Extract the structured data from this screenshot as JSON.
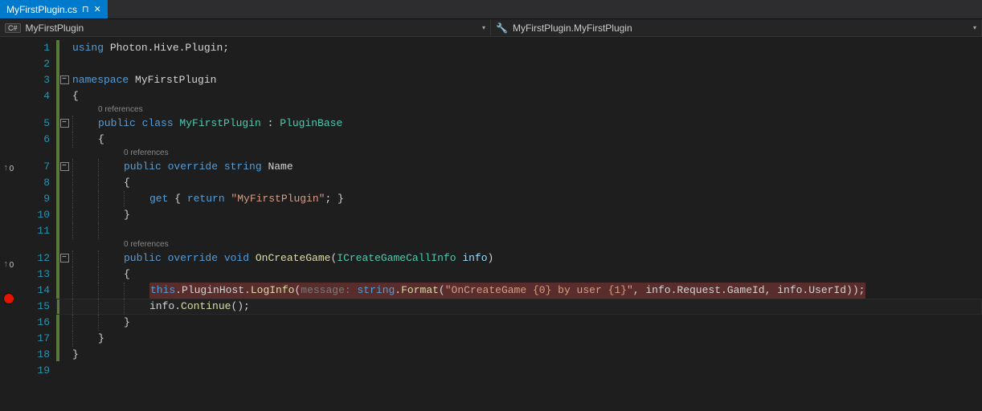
{
  "tab": {
    "filename": "MyFirstPlugin.cs",
    "pin_glyph": "⊓",
    "close_glyph": "✕"
  },
  "nav": {
    "left_badge": "C#",
    "left_text": "MyFirstPlugin",
    "right_icon": "🔧",
    "right_text": "MyFirstPlugin.MyFirstPlugin",
    "arrow": "▾"
  },
  "glyphs": {
    "impl_arrow": "↑",
    "impl_count": "0",
    "fold_minus": "−"
  },
  "codelens": {
    "ref0": "0 references"
  },
  "code": {
    "l1_using": "using",
    "l1_ns": " Photon.Hive.Plugin;",
    "l3_ns_kw": "namespace",
    "l3_ns_name": " MyFirstPlugin",
    "l4": "{",
    "l5_mods": "public class ",
    "l5_name": "MyFirstPlugin",
    "l5_colon": " : ",
    "l5_base": "PluginBase",
    "l6": "{",
    "l7_mods": "public override ",
    "l7_type": "string",
    "l7_name": " Name",
    "l8": "{",
    "l9_get": "get",
    "l9_open": " { ",
    "l9_ret": "return",
    "l9_str": " \"MyFirstPlugin\"",
    "l9_close": "; }",
    "l10": "}",
    "l12_mods": "public override ",
    "l12_type": "void",
    "l12_name": " OnCreateGame",
    "l12_paren_open": "(",
    "l12_ptype": "ICreateGameCallInfo",
    "l12_pname": " info",
    "l12_paren_close": ")",
    "l13": "{",
    "l14_this": "this",
    "l14_dot1": ".PluginHost.",
    "l14_log": "LogInfo",
    "l14_popen": "(",
    "l14_hint": "message: ",
    "l14_string": "string",
    "l14_dotfmt": ".",
    "l14_format": "Format",
    "l14_popen2": "(",
    "l14_fmtstr": "\"OnCreateGame {0} by user {1}\"",
    "l14_comma1": ", info.Request.GameId, info.UserId));",
    "l15_info": "info.",
    "l15_cont": "Continue",
    "l15_rest": "();",
    "l16": "}",
    "l17": "}",
    "l18": "}"
  },
  "lines": [
    "1",
    "2",
    "3",
    "4",
    "5",
    "6",
    "7",
    "8",
    "9",
    "10",
    "11",
    "12",
    "13",
    "14",
    "15",
    "16",
    "17",
    "18",
    "19"
  ]
}
